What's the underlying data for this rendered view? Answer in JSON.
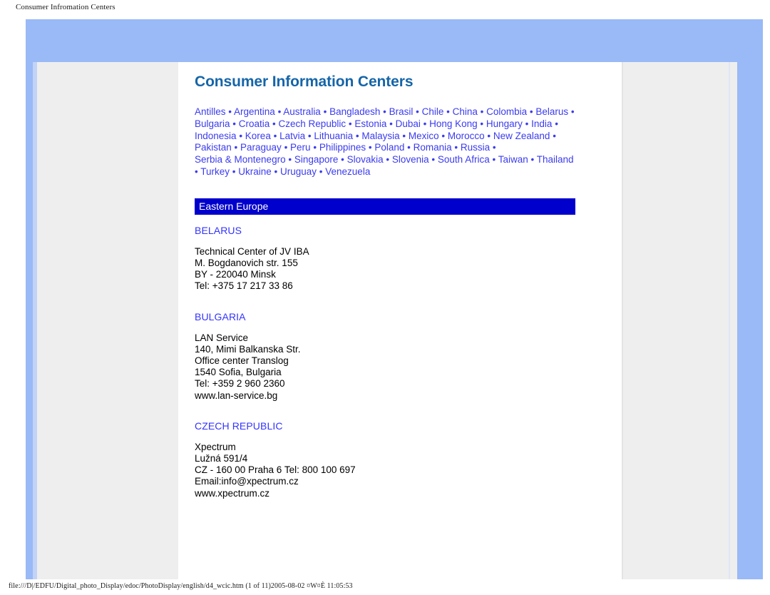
{
  "browser": {
    "print_header": "Consumer Infromation Centers",
    "print_footer": "file:///D|/EDFU/Digital_photo_Display/edoc/PhotoDisplay/english/d4_wcic.htm (1 of 11)2005-08-02 ¤W¤È 11:05:53"
  },
  "colors": {
    "frame_blue": "#99b9f7",
    "canvas_grey": "#eeeeee",
    "sheet_white": "#ffffff",
    "title_blue": "#1565a8",
    "link_blue": "#3b3bf0",
    "banner_blue": "#0000cc",
    "heading_blue": "#3333ff",
    "body_black": "#000000"
  },
  "document": {
    "title": "Consumer Information Centers",
    "country_links": [
      "Antilles",
      "Argentina",
      "Australia",
      "Bangladesh",
      "Brasil",
      "Chile",
      "China",
      "Colombia",
      "Belarus",
      "Bulgaria",
      "Croatia",
      "Czech Republic",
      "Estonia",
      "Dubai",
      "Hong Kong",
      "Hungary",
      "India",
      "Indonesia",
      "Korea",
      "Latvia",
      "Lithuania",
      "Malaysia",
      "Mexico",
      "Morocco",
      "New Zealand",
      "Pakistan",
      "Paraguay",
      "Peru",
      "Philippines",
      "Poland",
      "Romania",
      "Russia",
      "Serbia & Montenegro",
      "Singapore",
      "Slovakia",
      "Slovenia",
      "South Africa",
      "Taiwan",
      "Thailand",
      "Turkey",
      "Ukraine",
      "Uruguay",
      "Venezuela"
    ],
    "region_banner": "Eastern Europe",
    "entries": [
      {
        "country": "BELARUS",
        "lines": [
          "Technical Center of JV IBA",
          "M. Bogdanovich str. 155",
          "BY - 220040 Minsk",
          "Tel: +375 17 217 33 86"
        ]
      },
      {
        "country": "BULGARIA",
        "lines": [
          "LAN Service",
          "140, Mimi Balkanska Str.",
          "Office center Translog",
          "1540 Sofia, Bulgaria",
          "Tel: +359 2 960 2360",
          "www.lan-service.bg"
        ]
      },
      {
        "country": "CZECH REPUBLIC",
        "lines": [
          "Xpectrum",
          "Lužná 591/4",
          "CZ - 160 00 Praha 6 Tel: 800 100 697",
          "Email:info@xpectrum.cz",
          "www.xpectrum.cz"
        ]
      }
    ]
  }
}
